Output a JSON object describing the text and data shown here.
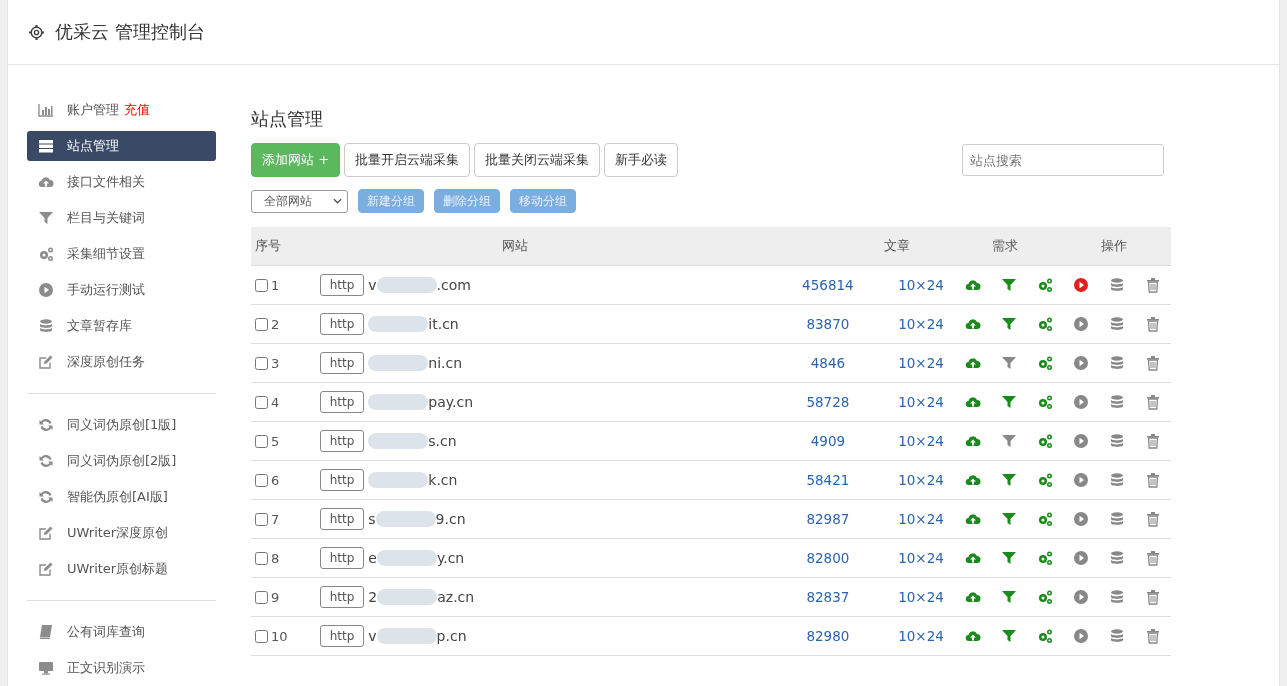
{
  "header": {
    "title": "优采云 管理控制台"
  },
  "sidebar": {
    "groups": [
      [
        {
          "kind": "chart",
          "label": "账户管理",
          "badge": "充值",
          "selected": false
        },
        {
          "kind": "server",
          "label": "站点管理",
          "selected": true
        },
        {
          "kind": "cloud",
          "label": "接口文件相关",
          "selected": false
        },
        {
          "kind": "filter",
          "label": "栏目与关键词",
          "selected": false
        },
        {
          "kind": "gears",
          "label": "采集细节设置",
          "selected": false
        },
        {
          "kind": "play",
          "label": "手动运行测试",
          "selected": false
        },
        {
          "kind": "database",
          "label": "文章暂存库",
          "selected": false
        },
        {
          "kind": "edit",
          "label": "深度原创任务",
          "selected": false
        }
      ],
      [
        {
          "kind": "refresh",
          "label": "同义词伪原创[1版]",
          "selected": false
        },
        {
          "kind": "refresh",
          "label": "同义词伪原创[2版]",
          "selected": false
        },
        {
          "kind": "refresh",
          "label": "智能伪原创[AI版]",
          "selected": false
        },
        {
          "kind": "edit",
          "label": "UWriter深度原创",
          "selected": false
        },
        {
          "kind": "edit",
          "label": "UWriter原创标题",
          "selected": false
        }
      ],
      [
        {
          "kind": "book",
          "label": "公有词库查询",
          "selected": false
        },
        {
          "kind": "monitor",
          "label": "正文识别演示",
          "selected": false
        }
      ]
    ]
  },
  "page_title": "站点管理",
  "toolbar": [
    {
      "kind": "primary",
      "label": "添加网站 +"
    },
    {
      "kind": "default",
      "label": "批量开启云端采集"
    },
    {
      "kind": "default",
      "label": "批量关闭云端采集"
    },
    {
      "kind": "default",
      "label": "新手必读"
    }
  ],
  "search": {
    "placeholder": "站点搜索"
  },
  "group_select": {
    "value": "全部网站"
  },
  "group_buttons": [
    "新建分组",
    "删除分组",
    "移动分组"
  ],
  "table": {
    "columns": [
      "序号",
      "网站",
      "文章",
      "需求",
      "操作"
    ],
    "rows": [
      {
        "checked": false,
        "index": "1",
        "protocol": "http",
        "prefix": "v",
        "suffix": ".com",
        "articles": "456814",
        "demand": "10×24",
        "filter": true,
        "running": true
      },
      {
        "checked": false,
        "index": "2",
        "protocol": "http",
        "prefix": "",
        "suffix": "it.cn",
        "articles": "83870",
        "demand": "10×24",
        "filter": true,
        "running": false
      },
      {
        "checked": false,
        "index": "3",
        "protocol": "http",
        "prefix": "",
        "suffix": "ni.cn",
        "articles": "4846",
        "demand": "10×24",
        "filter": false,
        "running": false
      },
      {
        "checked": false,
        "index": "4",
        "protocol": "http",
        "prefix": "",
        "suffix": "pay.cn",
        "articles": "58728",
        "demand": "10×24",
        "filter": true,
        "running": false
      },
      {
        "checked": false,
        "index": "5",
        "protocol": "http",
        "prefix": "",
        "suffix": "s.cn",
        "articles": "4909",
        "demand": "10×24",
        "filter": false,
        "running": false
      },
      {
        "checked": false,
        "index": "6",
        "protocol": "http",
        "prefix": "",
        "suffix": "k.cn",
        "articles": "58421",
        "demand": "10×24",
        "filter": true,
        "running": false
      },
      {
        "checked": false,
        "index": "7",
        "protocol": "http",
        "prefix": "s",
        "suffix": "9.cn",
        "articles": "82987",
        "demand": "10×24",
        "filter": true,
        "running": false
      },
      {
        "checked": false,
        "index": "8",
        "protocol": "http",
        "prefix": "e",
        "suffix": "y.cn",
        "articles": "82800",
        "demand": "10×24",
        "filter": true,
        "running": false
      },
      {
        "checked": false,
        "index": "9",
        "protocol": "http",
        "prefix": "2",
        "suffix": "az.cn",
        "articles": "82837",
        "demand": "10×24",
        "filter": true,
        "running": false
      },
      {
        "checked": false,
        "index": "10",
        "protocol": "http",
        "prefix": "v",
        "suffix": "p.cn",
        "articles": "82980",
        "demand": "10×24",
        "filter": true,
        "running": false
      }
    ]
  }
}
